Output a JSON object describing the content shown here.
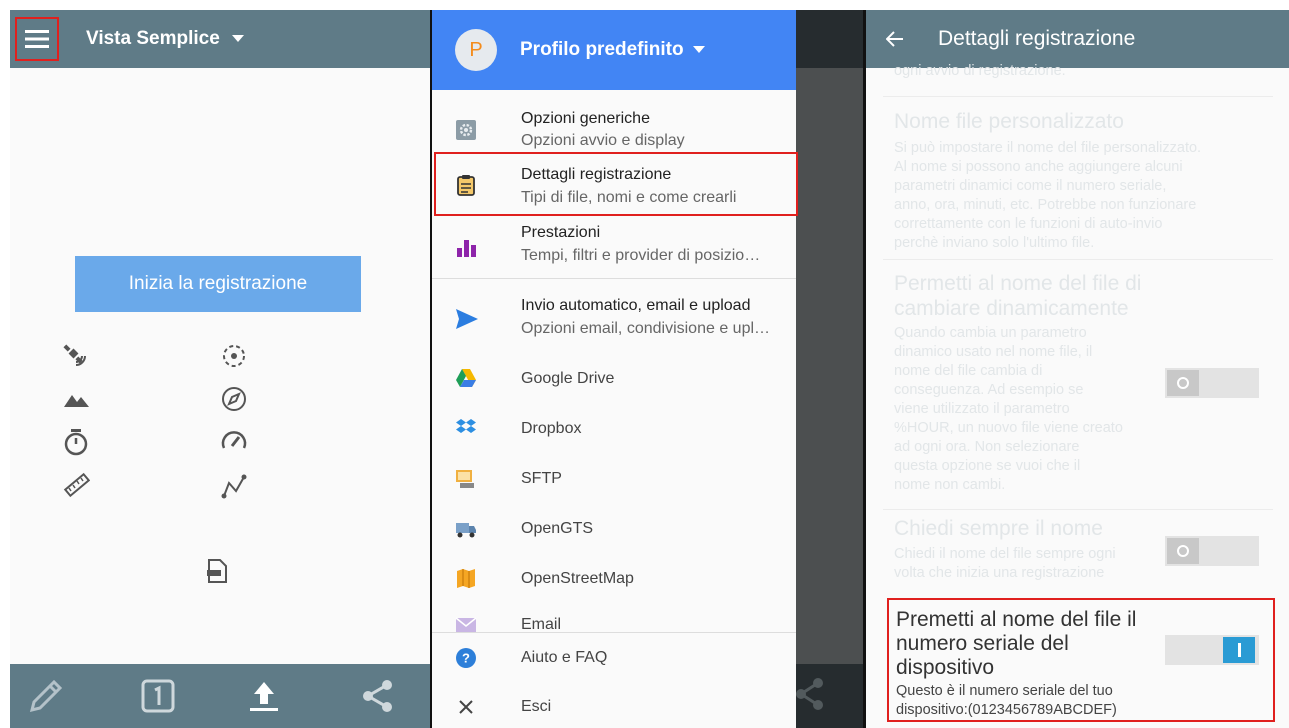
{
  "panel1": {
    "title": "Vista Semplice",
    "start_button": "Inizia la registrazione",
    "status_icons": [
      "satellite-icon",
      "gps-fix-icon",
      "altitude-icon",
      "compass-icon",
      "timer-icon",
      "speedometer-icon",
      "ruler-icon",
      "route-icon",
      "file-icon"
    ],
    "bottom_icons": [
      "pencil-icon",
      "one-icon",
      "upload-icon",
      "share-icon"
    ],
    "colors": {
      "toolbar": "#5f7b87",
      "button": "#6aa9ea",
      "highlight": "#e0201e"
    }
  },
  "drawer": {
    "avatar_letter": "P",
    "title": "Profilo predefinito",
    "items": [
      {
        "title": "Opzioni generiche",
        "subtitle": "Opzioni avvio e display",
        "icon": "settings-icon"
      },
      {
        "title": "Dettagli registrazione",
        "subtitle": "Tipi di file, nomi e come crearli",
        "icon": "clipboard-icon"
      },
      {
        "title": "Prestazioni",
        "subtitle": "Tempi, filtri e provider di posizio…",
        "icon": "bar-chart-icon"
      },
      {
        "title": "Invio automatico, email e upload",
        "subtitle": "Opzioni email, condivisione e upl…",
        "icon": "send-icon"
      }
    ],
    "targets": [
      {
        "label": "Google Drive",
        "icon": "google-drive-icon"
      },
      {
        "label": "Dropbox",
        "icon": "dropbox-icon"
      },
      {
        "label": "SFTP",
        "icon": "sftp-icon"
      },
      {
        "label": "OpenGTS",
        "icon": "truck-icon"
      },
      {
        "label": "OpenStreetMap",
        "icon": "map-icon"
      },
      {
        "label": "Email",
        "icon": "email-icon"
      }
    ],
    "footer": [
      {
        "label": "Aiuto e FAQ",
        "icon": "help-icon"
      },
      {
        "label": "Esci",
        "icon": "close-icon"
      }
    ]
  },
  "panel3": {
    "title": "Dettagli registrazione",
    "cut_line": "ogni avvio di registrazione.",
    "custom_name": {
      "title": "Nome file personalizzato",
      "lines": [
        "Si può impostare il nome del file personalizzato.",
        "Al nome si possono anche aggiungere alcuni",
        "parametri dinamici come il numero seriale,",
        "anno, ora, minuti, etc. Potrebbe non funzionare",
        "correttamente con le funzioni di auto-invio",
        "perchè inviano solo l'ultimo file."
      ]
    },
    "dynamic": {
      "title_lines": [
        "Permetti al nome del file di",
        "cambiare dinamicamente"
      ],
      "lines": [
        "Quando cambia un parametro",
        "dinamico usato nel nome file, il",
        "nome del file cambia di",
        "conseguenza. Ad esempio se",
        "viene utilizzato il parametro",
        "%HOUR, un nuovo file viene creato",
        "ad ogni ora. Non selezionare",
        "questa opzione se vuoi che il",
        "nome non cambi."
      ],
      "enabled": false
    },
    "ask_name": {
      "title": "Chiedi sempre il nome",
      "lines": [
        "Chiedi il nome del file sempre ogni",
        "volta che inizia una registrazione"
      ],
      "enabled": false
    },
    "serial": {
      "title_lines": [
        "Premetti al nome del file il",
        "numero seriale del",
        "dispositivo"
      ],
      "lines": [
        "Questo è il numero seriale del tuo",
        "dispositivo:(0123456789ABCDEF)"
      ],
      "enabled": true
    }
  }
}
